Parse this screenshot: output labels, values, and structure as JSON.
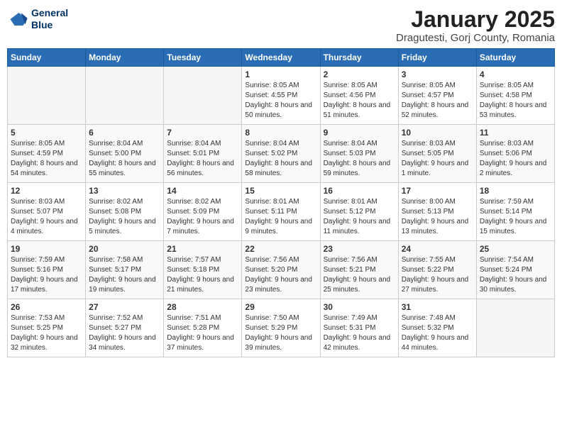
{
  "header": {
    "logo_line1": "General",
    "logo_line2": "Blue",
    "title": "January 2025",
    "subtitle": "Dragutesti, Gorj County, Romania"
  },
  "days_of_week": [
    "Sunday",
    "Monday",
    "Tuesday",
    "Wednesday",
    "Thursday",
    "Friday",
    "Saturday"
  ],
  "weeks": [
    [
      {
        "day": "",
        "info": ""
      },
      {
        "day": "",
        "info": ""
      },
      {
        "day": "",
        "info": ""
      },
      {
        "day": "1",
        "info": "Sunrise: 8:05 AM\nSunset: 4:55 PM\nDaylight: 8 hours\nand 50 minutes."
      },
      {
        "day": "2",
        "info": "Sunrise: 8:05 AM\nSunset: 4:56 PM\nDaylight: 8 hours\nand 51 minutes."
      },
      {
        "day": "3",
        "info": "Sunrise: 8:05 AM\nSunset: 4:57 PM\nDaylight: 8 hours\nand 52 minutes."
      },
      {
        "day": "4",
        "info": "Sunrise: 8:05 AM\nSunset: 4:58 PM\nDaylight: 8 hours\nand 53 minutes."
      }
    ],
    [
      {
        "day": "5",
        "info": "Sunrise: 8:05 AM\nSunset: 4:59 PM\nDaylight: 8 hours\nand 54 minutes."
      },
      {
        "day": "6",
        "info": "Sunrise: 8:04 AM\nSunset: 5:00 PM\nDaylight: 8 hours\nand 55 minutes."
      },
      {
        "day": "7",
        "info": "Sunrise: 8:04 AM\nSunset: 5:01 PM\nDaylight: 8 hours\nand 56 minutes."
      },
      {
        "day": "8",
        "info": "Sunrise: 8:04 AM\nSunset: 5:02 PM\nDaylight: 8 hours\nand 58 minutes."
      },
      {
        "day": "9",
        "info": "Sunrise: 8:04 AM\nSunset: 5:03 PM\nDaylight: 8 hours\nand 59 minutes."
      },
      {
        "day": "10",
        "info": "Sunrise: 8:03 AM\nSunset: 5:05 PM\nDaylight: 9 hours\nand 1 minute."
      },
      {
        "day": "11",
        "info": "Sunrise: 8:03 AM\nSunset: 5:06 PM\nDaylight: 9 hours\nand 2 minutes."
      }
    ],
    [
      {
        "day": "12",
        "info": "Sunrise: 8:03 AM\nSunset: 5:07 PM\nDaylight: 9 hours\nand 4 minutes."
      },
      {
        "day": "13",
        "info": "Sunrise: 8:02 AM\nSunset: 5:08 PM\nDaylight: 9 hours\nand 5 minutes."
      },
      {
        "day": "14",
        "info": "Sunrise: 8:02 AM\nSunset: 5:09 PM\nDaylight: 9 hours\nand 7 minutes."
      },
      {
        "day": "15",
        "info": "Sunrise: 8:01 AM\nSunset: 5:11 PM\nDaylight: 9 hours\nand 9 minutes."
      },
      {
        "day": "16",
        "info": "Sunrise: 8:01 AM\nSunset: 5:12 PM\nDaylight: 9 hours\nand 11 minutes."
      },
      {
        "day": "17",
        "info": "Sunrise: 8:00 AM\nSunset: 5:13 PM\nDaylight: 9 hours\nand 13 minutes."
      },
      {
        "day": "18",
        "info": "Sunrise: 7:59 AM\nSunset: 5:14 PM\nDaylight: 9 hours\nand 15 minutes."
      }
    ],
    [
      {
        "day": "19",
        "info": "Sunrise: 7:59 AM\nSunset: 5:16 PM\nDaylight: 9 hours\nand 17 minutes."
      },
      {
        "day": "20",
        "info": "Sunrise: 7:58 AM\nSunset: 5:17 PM\nDaylight: 9 hours\nand 19 minutes."
      },
      {
        "day": "21",
        "info": "Sunrise: 7:57 AM\nSunset: 5:18 PM\nDaylight: 9 hours\nand 21 minutes."
      },
      {
        "day": "22",
        "info": "Sunrise: 7:56 AM\nSunset: 5:20 PM\nDaylight: 9 hours\nand 23 minutes."
      },
      {
        "day": "23",
        "info": "Sunrise: 7:56 AM\nSunset: 5:21 PM\nDaylight: 9 hours\nand 25 minutes."
      },
      {
        "day": "24",
        "info": "Sunrise: 7:55 AM\nSunset: 5:22 PM\nDaylight: 9 hours\nand 27 minutes."
      },
      {
        "day": "25",
        "info": "Sunrise: 7:54 AM\nSunset: 5:24 PM\nDaylight: 9 hours\nand 30 minutes."
      }
    ],
    [
      {
        "day": "26",
        "info": "Sunrise: 7:53 AM\nSunset: 5:25 PM\nDaylight: 9 hours\nand 32 minutes."
      },
      {
        "day": "27",
        "info": "Sunrise: 7:52 AM\nSunset: 5:27 PM\nDaylight: 9 hours\nand 34 minutes."
      },
      {
        "day": "28",
        "info": "Sunrise: 7:51 AM\nSunset: 5:28 PM\nDaylight: 9 hours\nand 37 minutes."
      },
      {
        "day": "29",
        "info": "Sunrise: 7:50 AM\nSunset: 5:29 PM\nDaylight: 9 hours\nand 39 minutes."
      },
      {
        "day": "30",
        "info": "Sunrise: 7:49 AM\nSunset: 5:31 PM\nDaylight: 9 hours\nand 42 minutes."
      },
      {
        "day": "31",
        "info": "Sunrise: 7:48 AM\nSunset: 5:32 PM\nDaylight: 9 hours\nand 44 minutes."
      },
      {
        "day": "",
        "info": ""
      }
    ]
  ]
}
